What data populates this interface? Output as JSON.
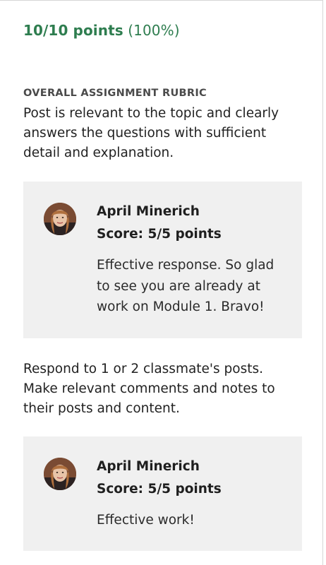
{
  "summary": {
    "score": "10/10 points",
    "percent": "(100%)"
  },
  "rubric": {
    "heading": "OVERALL ASSIGNMENT RUBRIC",
    "criteria": [
      {
        "text": "Post is relevant to the topic and clearly answers the questions with sufficient detail and explanation.",
        "feedback": {
          "grader": "April Minerich",
          "score": "Score: 5/5 points",
          "comment": "Effective response. So glad to see you are already at work on Module 1. Bravo!"
        }
      },
      {
        "text": "Respond to 1 or 2 classmate's posts. Make relevant comments and notes to their posts and content.",
        "feedback": {
          "grader": "April Minerich",
          "score": "Score: 5/5 points",
          "comment": "Effective work!"
        }
      }
    ]
  },
  "colors": {
    "score_green": "#2e7d4f",
    "card_background": "#f0f0f0",
    "panel_border": "#d6d6d6"
  },
  "icons": {
    "avatar": "grader-avatar-photo"
  }
}
